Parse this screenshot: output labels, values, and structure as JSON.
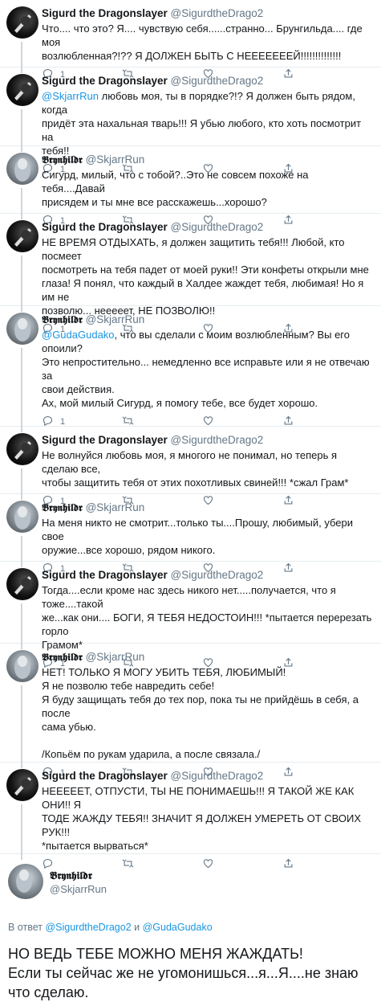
{
  "tweets": [
    {
      "name": "Sigurd the Dragonslayer",
      "handle": "@SigurdtheDrago2",
      "lines": [
        "Что.... что это? Я.... чувствую себя......странно... Брунгильда.... где моя",
        "возлюбленная?!?? Я ДОЛЖЕН БЫТЬ С НЕЕЕЕЕЕЕЙ!!!!!!!!!!!!!!"
      ],
      "reply_count": "1"
    },
    {
      "name": "Sigurd the Dragonslayer",
      "handle": "@SigurdtheDrago2",
      "mention": "@SkjarrRun",
      "lines": [
        " любовь моя, ты в порядке?!? Я должен быть рядом, когда",
        "придёт эта нахальная тварь!!! Я убью любого, кто хоть посмотрит на",
        "тебя!!"
      ],
      "reply_count": "1"
    },
    {
      "name": "𝕭𝖗𝖞𝖓𝖍𝖎𝖑𝖉𝖗",
      "handle": "@SkjarrRun",
      "lines": [
        "Сигурд, милый, что с тобой?..Это не совсем похоже на тебя....Давай",
        "присядем и ты мне все расскажешь...хорошо?"
      ],
      "reply_count": "1"
    },
    {
      "name": "Sigurd the Dragonslayer",
      "handle": "@SigurdtheDrago2",
      "lines": [
        "НЕ ВРЕМЯ ОТДЫХАТЬ, я должен защитить тебя!!! Любой, кто посмеет",
        "посмотреть на тебя падет от моей руки!! Эти конфеты открыли мне",
        "глаза! Я понял, что каждый в Халдее жаждет тебя, любимая! Но я им не",
        "позволю... неееeет, НЕ ПОЗВОЛЮ!!"
      ],
      "reply_count": "1"
    },
    {
      "name": "𝕭𝖗𝖞𝖓𝖍𝖎𝖑𝖉𝖗",
      "handle": "@SkjarrRun",
      "mention": "@GudaGudako",
      "lines": [
        ", что вы сделали с моим возлюбленным? Вы его опоили?",
        "Это непростительно... немедленно все исправьте или я не отвечаю за",
        "свои действия.",
        "Ах, мой милый Сигурд, я помогу тебе, все будет хорошо."
      ],
      "reply_count": "1"
    },
    {
      "name": "Sigurd the Dragonslayer",
      "handle": "@SigurdtheDrago2",
      "lines": [
        "Не волнуйся любовь моя, я многого не понимал, но теперь я сделаю все,",
        "чтобы защитить тебя от этих похотливых свиней!!! *сжал Грам*"
      ],
      "reply_count": "1"
    },
    {
      "name": "𝕭𝖗𝖞𝖓𝖍𝖎𝖑𝖉𝖗",
      "handle": "@SkjarrRun",
      "lines": [
        "На меня никто не смотрит...только ты....Прошу, любимый, убери свое",
        "оружие...все хорошо, рядом никого."
      ],
      "reply_count": "1"
    },
    {
      "name": "Sigurd the Dragonslayer",
      "handle": "@SigurdtheDrago2",
      "lines": [
        "Тогда....если кроме нас здесь никого нет.....получается, что я тоже....такой",
        "же...как они.... БОГИ, Я ТЕБЯ НЕДОСТОИН!!! *пытается перерезать горло",
        "Грамом*"
      ],
      "reply_count": "1"
    },
    {
      "name": "𝕭𝖗𝖞𝖓𝖍𝖎𝖑𝖉𝖗",
      "handle": "@SkjarrRun",
      "lines": [
        "НЕТ! ТОЛЬКО Я МОГУ УБИТЬ ТЕБЯ, ЛЮБИМЫЙ!",
        "Я не позволю тебе навредить себе!",
        "Я буду защищать тебя до тех пор, пока ты не прийдёшь в себя, а после",
        "сама убью.",
        "",
        "/Копьём по рукам ударила, а после связала./"
      ],
      "reply_count": "1"
    },
    {
      "name": "Sigurd the Dragonslayer",
      "handle": "@SigurdtheDrago2",
      "lines": [
        "НЕЕЕЕЕТ, ОТПУСТИ, ТЫ НЕ ПОНИМАЕШЬ!!! Я ТАКОЙ ЖЕ КАК ОНИ!!  Я",
        "ТОДЕ ЖАЖДУ ТЕБЯ!! ЗНАЧИТ Я ДОЛЖЕН УМЕРЕТЬ ОТ СВОИХ РУК!!!",
        "*пытается вырваться*"
      ],
      "reply_count": ""
    }
  ],
  "main": {
    "name": "𝕭𝖗𝖞𝖓𝖍𝖎𝖑𝖉𝖗",
    "handle": "@SkjarrRun",
    "reply_prefix": "В ответ ",
    "reply_user1": "@SigurdtheDrago2",
    "reply_and": " и ",
    "reply_user2": "@GudaGudako",
    "lines": [
      "НО ВЕДЬ ТЕБЕ МОЖНО МЕНЯ ЖАЖДАТЬ!",
      "Если ты сейчас же не угомонишься...я...Я....не знаю",
      "что сделаю."
    ]
  },
  "colors": {
    "link": "#1b95e0",
    "muted": "#657786"
  }
}
